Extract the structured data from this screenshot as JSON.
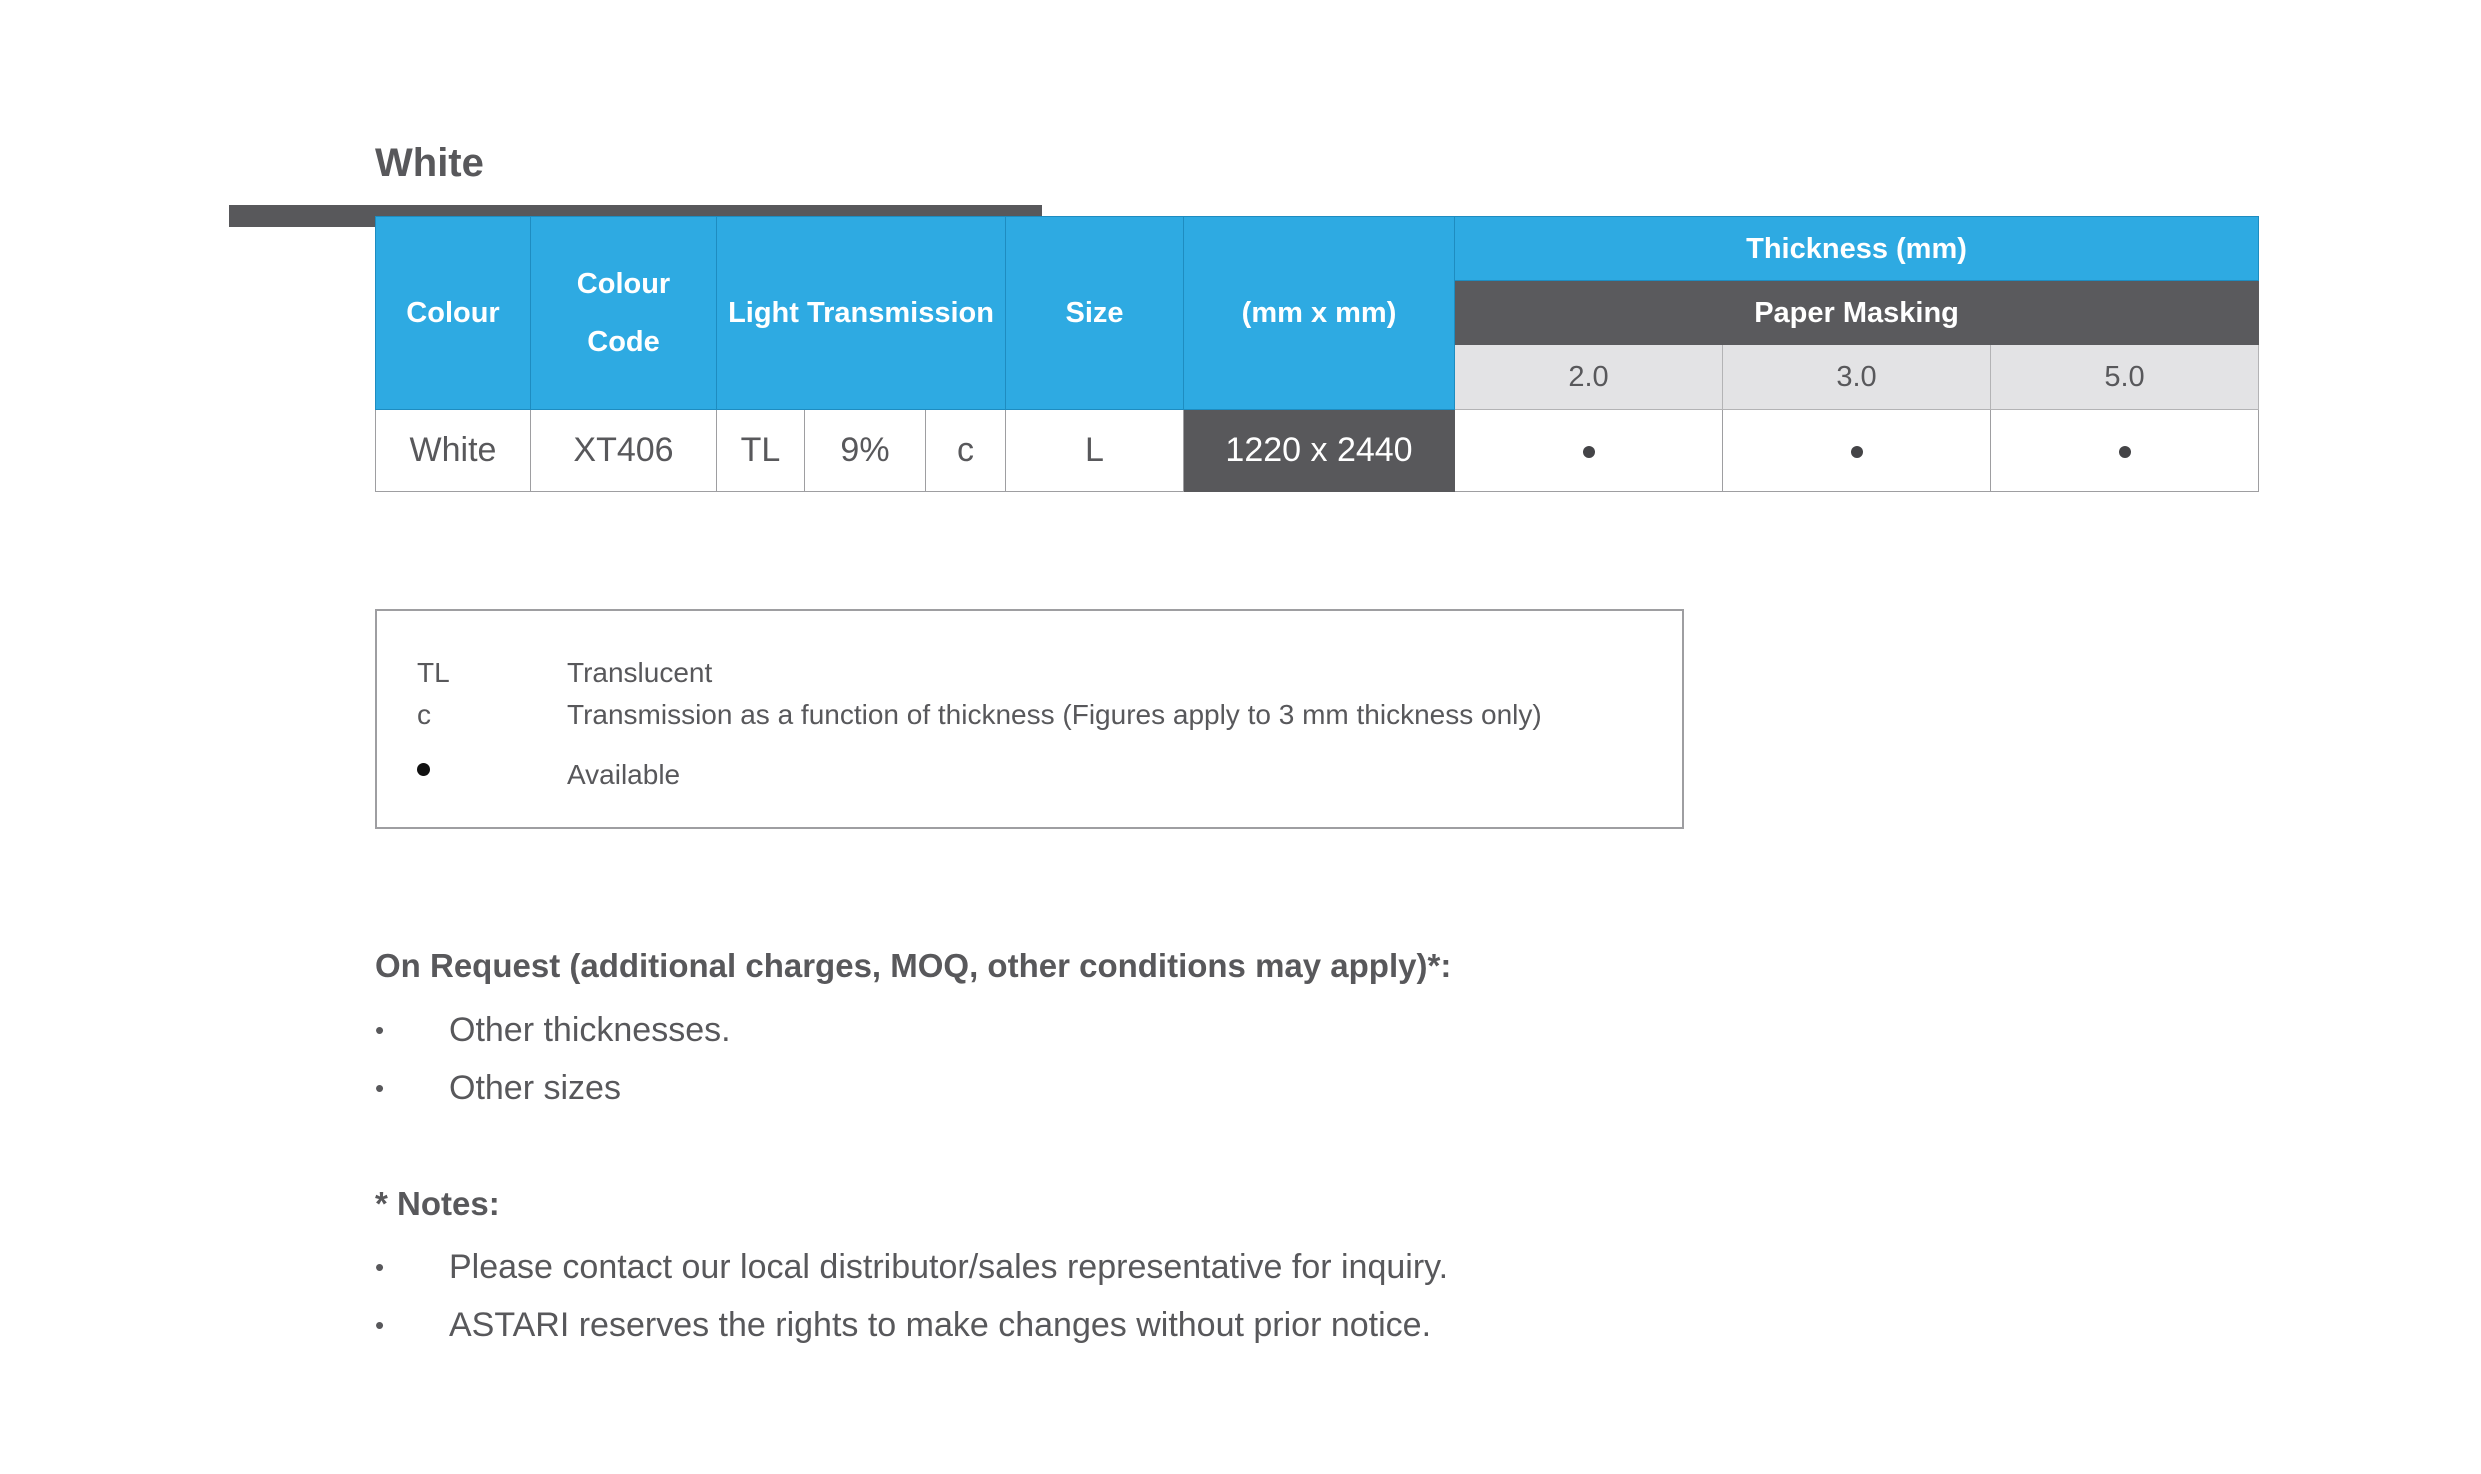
{
  "heading": "White",
  "table": {
    "headers": {
      "colour": "Colour",
      "colour_code_line1": "Colour",
      "colour_code_line2": "Code",
      "light_transmission": "Light Transmission",
      "size": "Size",
      "dimensions": "(mm x mm)",
      "thickness": "Thickness (mm)",
      "masking": "Paper Masking",
      "thicknesses": [
        "2.0",
        "3.0",
        "5.0"
      ]
    },
    "row": {
      "colour": "White",
      "colour_code": "XT406",
      "transmission_type": "TL",
      "transmission_value": "9%",
      "transmission_note": "c",
      "size": "L",
      "dimensions": "1220 x 2440",
      "availability": [
        "available",
        "available",
        "available"
      ]
    }
  },
  "legend": [
    {
      "key": "TL",
      "description": "Translucent"
    },
    {
      "key": "c",
      "description": "Transmission as a function of thickness (Figures apply to 3 mm thickness only)"
    },
    {
      "key": "dot-icon",
      "description": "Available"
    }
  ],
  "on_request": {
    "title": "On Request (additional charges, MOQ, other conditions may apply)*:",
    "bullet": "•",
    "items": [
      "Other thicknesses.",
      "Other sizes"
    ]
  },
  "notes": {
    "title": "* Notes:",
    "bullet": "•",
    "items": [
      "Please contact our local distributor/sales representative for inquiry.",
      "ASTARI reserves the rights to make changes without prior notice."
    ]
  }
}
